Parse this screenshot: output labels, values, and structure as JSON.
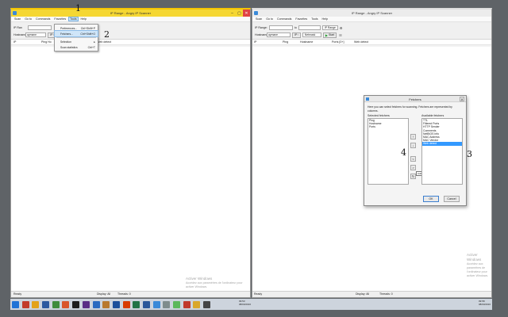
{
  "left": {
    "title": "IP Range - Angry IP Scanner",
    "menu": [
      "Scan",
      "Go to",
      "Commands",
      "Favorites",
      "Tools",
      "Help"
    ],
    "active_menu_index": 4,
    "ip_label": "IP Ran",
    "hostname_label": "Hostname:",
    "hostname_value": "aymane",
    "ip_button": "IP↑",
    "columns": [
      "IP",
      "Ping",
      "Ho",
      "Web detect"
    ],
    "tools_menu": [
      {
        "label": "Preferences...",
        "shortcut": "Ctrl+Shift+P"
      },
      {
        "label": "Fetchers...",
        "shortcut": "Ctrl+Shift+O"
      },
      {
        "label": "Selection",
        "shortcut": "▸"
      },
      {
        "label": "Scan statistics",
        "shortcut": "Ctrl+T"
      }
    ],
    "status": {
      "left": "Ready",
      "mid": "Display: All",
      "right": "Threads: 0"
    },
    "watermark_title": "Activer Windows",
    "watermark_sub1": "Accédez aux paramètres de l'ordinateur pour",
    "watermark_sub2": "activer Windows."
  },
  "right": {
    "title": "IP Range - Angry IP Scanner",
    "menu": [
      "Scan",
      "Go to",
      "Commands",
      "Favorites",
      "Tools",
      "Help"
    ],
    "ip_label": "IP Range:",
    "hostname_label": "Hostname:",
    "hostname_value": "aymane",
    "ip_button": "IP↑",
    "netmask": "Netmask",
    "range_select": "IP Range",
    "start_label": "Start",
    "columns": [
      "IP",
      "Ping",
      "Hostname",
      "Ports [0+]",
      "Web detect"
    ],
    "status": {
      "left": "Ready",
      "mid": "Display: All",
      "right": "Threads: 0"
    },
    "watermark_title": "Activer Windows",
    "watermark_sub1": "Accédez aux paramètres de l'ordinateur pour",
    "watermark_sub2": "activer Windows."
  },
  "dialog": {
    "title": "Fetchers",
    "description": "Here you can select fetchers for scanning. Fetchers are represented by columns.",
    "selected_label": "Selected fetchers",
    "available_label": "Available fetchers",
    "selected": [
      "Ping",
      "Hostname",
      "Ports"
    ],
    "available": [
      "TTL",
      "Filtered Ports",
      "HTTP Sender",
      "Comments",
      "NetBIOS Info",
      "MAC Address",
      "MAC Vendor",
      "Web detect"
    ],
    "selected_available_index": 7,
    "mid_buttons": [
      "↑",
      "↓",
      "<",
      ">",
      "↻"
    ],
    "tooltip": "Add",
    "ok": "OK",
    "cancel": "Cancel"
  },
  "callouts": [
    "1",
    "2",
    "3",
    "4"
  ],
  "taskbar": {
    "clock_left": [
      "09:53",
      "08/03/2016"
    ],
    "clock_right": [
      "09:58",
      "08/03/2016"
    ]
  },
  "colors": {
    "title_active": "#f5d733",
    "close": "#e04343",
    "selection": "#3399ff"
  }
}
